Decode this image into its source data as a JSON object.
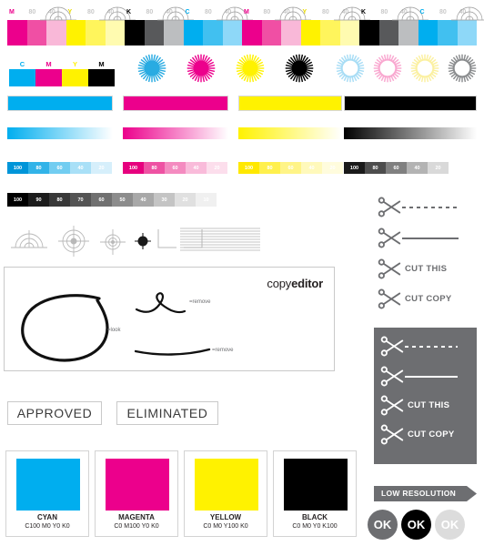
{
  "top_strip": {
    "groups": [
      {
        "label_main": "M",
        "labels": [
          "M",
          "80",
          "40"
        ],
        "colors": [
          "#ec008c",
          "#f04fa4",
          "#f9b8d8"
        ]
      },
      {
        "label_main": "Y",
        "labels": [
          "Y",
          "80",
          "40"
        ],
        "colors": [
          "#fff200",
          "#fff55c",
          "#fffbb0"
        ]
      },
      {
        "label_main": "K",
        "labels": [
          "K",
          "80",
          "40"
        ],
        "colors": [
          "#000000",
          "#58595b",
          "#bcbec0"
        ]
      },
      {
        "label_main": "C",
        "labels": [
          "C",
          "80",
          "40"
        ],
        "colors": [
          "#00aeef",
          "#41c0f0",
          "#8ed8f8"
        ]
      },
      {
        "label_main": "M",
        "labels": [
          "M",
          "80",
          "40"
        ],
        "colors": [
          "#ec008c",
          "#f04fa4",
          "#f9b8d8"
        ]
      },
      {
        "label_main": "Y",
        "labels": [
          "Y",
          "80",
          "40"
        ],
        "colors": [
          "#fff200",
          "#fff55c",
          "#fffbb0"
        ]
      },
      {
        "label_main": "K",
        "labels": [
          "K",
          "80",
          "40"
        ],
        "colors": [
          "#000000",
          "#58595b",
          "#bcbec0"
        ]
      },
      {
        "label_main": "C",
        "labels": [
          "C",
          "80",
          "40"
        ],
        "colors": [
          "#00aeef",
          "#41c0f0",
          "#8ed8f8"
        ]
      }
    ]
  },
  "mini_strip": {
    "labels": [
      "C",
      "M",
      "Y",
      "M"
    ],
    "label_colors": [
      "#00aeef",
      "#ec008c",
      "#fff200",
      "#000000"
    ],
    "colors": [
      "#00aeef",
      "#ec008c",
      "#fff200",
      "#000000"
    ]
  },
  "rosettes": {
    "solid": [
      {
        "name": "cyan-rosette",
        "color": "#29abe2"
      },
      {
        "name": "magenta-rosette",
        "color": "#ec008c"
      },
      {
        "name": "yellow-rosette",
        "color": "#fff200"
      },
      {
        "name": "black-rosette",
        "color": "#000000"
      }
    ],
    "outline": [
      {
        "name": "cyan-rosette-light",
        "color": "#a8ddf5"
      },
      {
        "name": "magenta-rosette-light",
        "color": "#f9a8d0"
      },
      {
        "name": "yellow-rosette-light",
        "color": "#fbf0a0"
      },
      {
        "name": "black-rosette-light",
        "color": "#8a8c8e"
      }
    ]
  },
  "bars": {
    "solid": [
      {
        "name": "cyan-solid-bar",
        "color": "#00aeef"
      },
      {
        "name": "magenta-solid-bar",
        "color": "#ec008c"
      },
      {
        "name": "yellow-solid-bar",
        "color": "#fff200"
      },
      {
        "name": "black-solid-bar",
        "color": "#000000"
      }
    ],
    "gradient": [
      {
        "name": "cyan-gradient-bar",
        "from": "#00aeef",
        "to": "#ffffff"
      },
      {
        "name": "magenta-gradient-bar",
        "from": "#ec008c",
        "to": "#ffffff"
      },
      {
        "name": "yellow-gradient-bar",
        "from": "#fff200",
        "to": "#ffffff"
      },
      {
        "name": "black-gradient-bar",
        "from": "#000000",
        "to": "#ffffff"
      }
    ]
  },
  "tint_scales": {
    "steps": [
      "100",
      "80",
      "60",
      "40",
      "20"
    ],
    "rows": [
      {
        "name": "cyan-tint-scale",
        "colors": [
          "#0095d9",
          "#32b3e8",
          "#72cdf1",
          "#a9e0f7",
          "#d6effb"
        ]
      },
      {
        "name": "magenta-tint-scale",
        "colors": [
          "#e6007e",
          "#ee52a3",
          "#f48bc0",
          "#f9bbda",
          "#fcdeec"
        ]
      },
      {
        "name": "yellow-tint-scale",
        "colors": [
          "#ffe800",
          "#fff04d",
          "#fff487",
          "#fff9bb",
          "#fffcdd"
        ]
      },
      {
        "name": "black-tint-scale",
        "colors": [
          "#1a1a1a",
          "#4d4d4d",
          "#808080",
          "#b3b3b3",
          "#d9d9d9"
        ]
      }
    ]
  },
  "gray_wedge": {
    "name": "gray-step-wedge",
    "steps": [
      "100",
      "90",
      "80",
      "70",
      "60",
      "50",
      "40",
      "30",
      "20",
      "10"
    ],
    "colors": [
      "#000000",
      "#1c1c1c",
      "#383838",
      "#545454",
      "#707070",
      "#8c8c8c",
      "#a8a8a8",
      "#c4c4c4",
      "#e0e0e0",
      "#f0f0f0"
    ]
  },
  "marks": {
    "items": [
      "half-registration-target",
      "large-registration-target",
      "small-registration-target",
      "solid-dot-target",
      "corner-crop-mark-left",
      "corner-crop-mark-right",
      "line-screen-pattern"
    ]
  },
  "copyeditor": {
    "logo_part1": "copy",
    "logo_part2": "editor",
    "annotations": [
      {
        "name": "look-annotation",
        "text": "=look"
      },
      {
        "name": "remove-annotation-top",
        "text": "=remove"
      },
      {
        "name": "remove-annotation-bottom",
        "text": "=remove"
      }
    ]
  },
  "stamps": [
    {
      "name": "approved-stamp",
      "label": "APPROVED"
    },
    {
      "name": "eliminated-stamp",
      "label": "ELIMINATED"
    }
  ],
  "swatch_cards": [
    {
      "name": "cyan-swatch-card",
      "color": "#00aeef",
      "title": "CYAN",
      "formula": "C100 M0 Y0 K0"
    },
    {
      "name": "magenta-swatch-card",
      "color": "#ec008c",
      "title": "MAGENTA",
      "formula": "C0 M100 Y0 K0"
    },
    {
      "name": "yellow-swatch-card",
      "color": "#fff200",
      "title": "YELLOW",
      "formula": "C0 M0 Y100 K0"
    },
    {
      "name": "black-swatch-card",
      "color": "#000000",
      "title": "BLACK",
      "formula": "C0 M0 Y0 K100"
    }
  ],
  "scissors_light": [
    {
      "name": "scissors-dashed-line",
      "label": "",
      "line": "dashed"
    },
    {
      "name": "scissors-solid-line",
      "label": "",
      "line": "solid"
    },
    {
      "name": "scissors-cut-this",
      "label": "CUT THIS",
      "line": "none"
    },
    {
      "name": "scissors-cut-copy",
      "label": "CUT COPY",
      "line": "none"
    }
  ],
  "scissors_dark": [
    {
      "name": "scissors-dashed-line-inverse",
      "label": "",
      "line": "dashed"
    },
    {
      "name": "scissors-solid-line-inverse",
      "label": "",
      "line": "solid"
    },
    {
      "name": "scissors-cut-this-inverse",
      "label": "CUT THIS",
      "line": "none"
    },
    {
      "name": "scissors-cut-copy-inverse",
      "label": "CUT COPY",
      "line": "none"
    }
  ],
  "low_resolution": {
    "label": "LOW RESOLUTION",
    "background": "#6d6e71"
  },
  "ok_badges": [
    {
      "name": "ok-badge-gray",
      "label": "OK",
      "background": "#6d6e71"
    },
    {
      "name": "ok-badge-black",
      "label": "OK",
      "background": "#000000"
    },
    {
      "name": "ok-badge-light",
      "label": "OK",
      "background": "#dcdcdc"
    }
  ],
  "palette": {
    "cyan": "#00aeef",
    "magenta": "#ec008c",
    "yellow": "#fff200",
    "black": "#000000",
    "gray": "#6d6e71",
    "mark_gray": "#b9b9b9"
  }
}
